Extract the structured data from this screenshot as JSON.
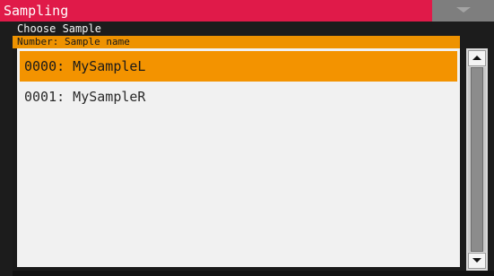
{
  "title_bar": {
    "title": "Sampling",
    "menu_icon": "chevron-down-icon",
    "color": "#e01a49"
  },
  "panel": {
    "label": "Choose Sample"
  },
  "list": {
    "header": "Number:  Sample name",
    "header_color": "#ee9200",
    "selection_color": "#f39300",
    "items": [
      {
        "label": "0000: MySampleL",
        "selected": true
      },
      {
        "label": "0001: MySampleR",
        "selected": false
      }
    ]
  },
  "scrollbar": {
    "up_icon": "scroll-up-arrow-icon",
    "down_icon": "scroll-down-arrow-icon"
  }
}
